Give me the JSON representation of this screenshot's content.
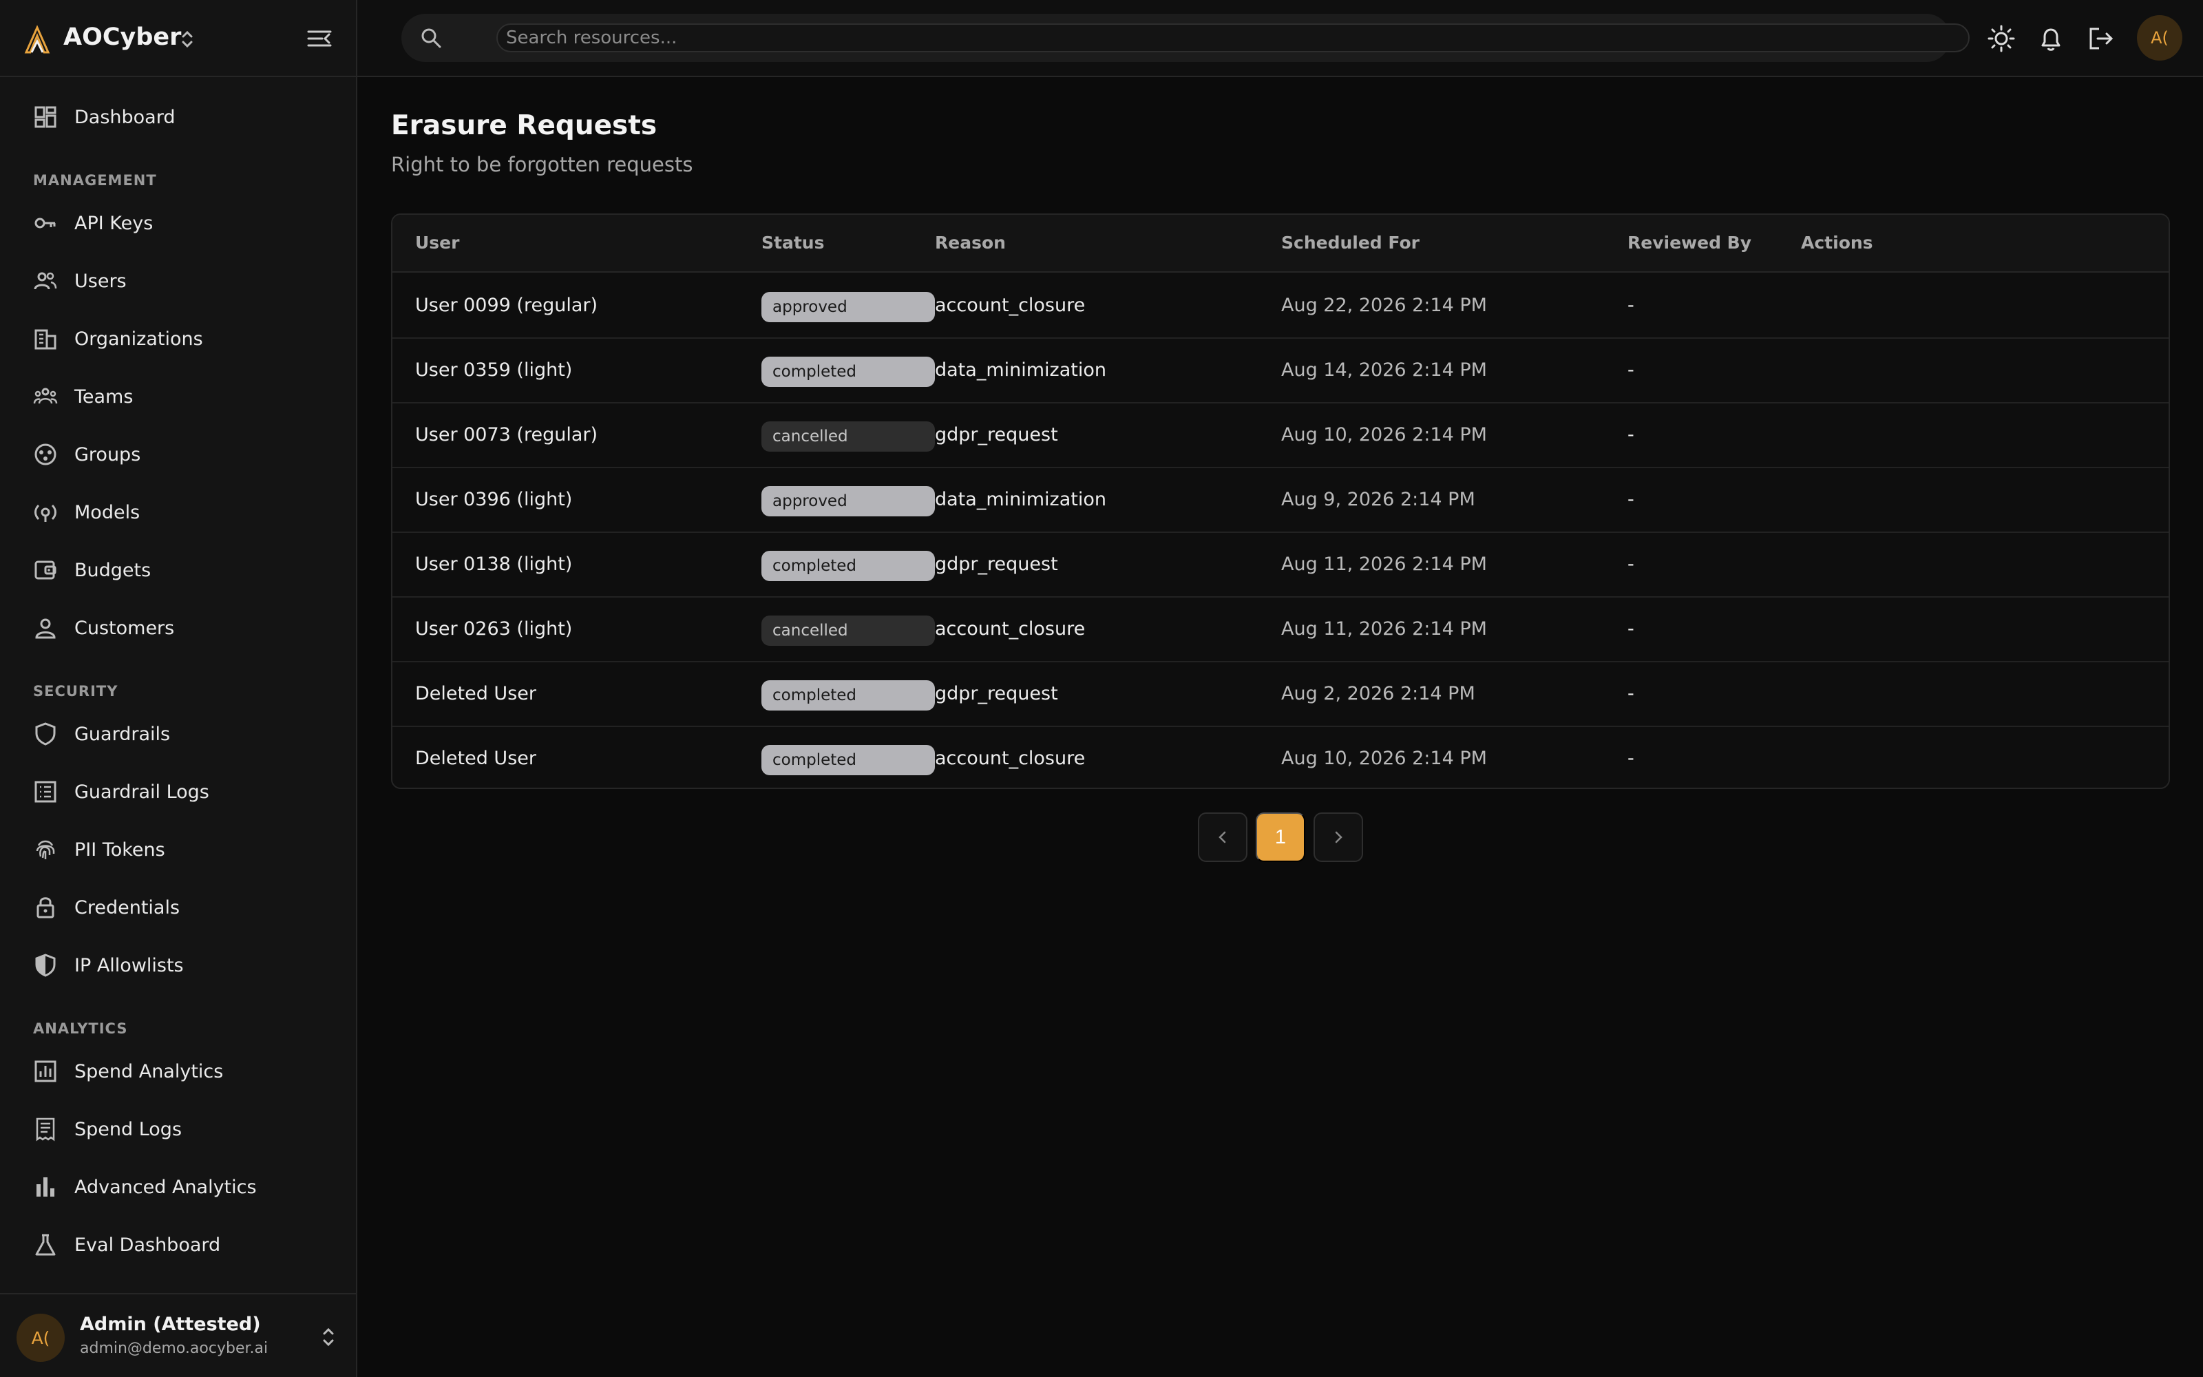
{
  "brand": {
    "name": "AOCyber"
  },
  "search": {
    "placeholder": "Search resources..."
  },
  "nav": {
    "dashboard": "Dashboard",
    "management": {
      "title": "MANAGEMENT",
      "items": [
        "API Keys",
        "Users",
        "Organizations",
        "Teams",
        "Groups",
        "Models",
        "Budgets",
        "Customers"
      ]
    },
    "security": {
      "title": "SECURITY",
      "items": [
        "Guardrails",
        "Guardrail Logs",
        "PII Tokens",
        "Credentials",
        "IP Allowlists"
      ]
    },
    "analytics": {
      "title": "ANALYTICS",
      "items": [
        "Spend Analytics",
        "Spend Logs",
        "Advanced Analytics",
        "Eval Dashboard"
      ]
    }
  },
  "user": {
    "initials": "A(",
    "name": "Admin (Attested)",
    "email": "admin@demo.aocyber.ai"
  },
  "page": {
    "title": "Erasure Requests",
    "subtitle": "Right to be forgotten requests"
  },
  "table": {
    "headers": {
      "user": "User",
      "status": "Status",
      "reason": "Reason",
      "scheduled": "Scheduled For",
      "reviewed": "Reviewed By",
      "actions": "Actions"
    },
    "rows": [
      {
        "user": "User 0099 (regular)",
        "status": "approved",
        "reason": "account_closure",
        "scheduled": "Aug 22, 2026 2:14 PM",
        "reviewed": "-"
      },
      {
        "user": "User 0359 (light)",
        "status": "completed",
        "reason": "data_minimization",
        "scheduled": "Aug 14, 2026 2:14 PM",
        "reviewed": "-"
      },
      {
        "user": "User 0073 (regular)",
        "status": "cancelled",
        "reason": "gdpr_request",
        "scheduled": "Aug 10, 2026 2:14 PM",
        "reviewed": "-"
      },
      {
        "user": "User 0396 (light)",
        "status": "approved",
        "reason": "data_minimization",
        "scheduled": "Aug 9, 2026 2:14 PM",
        "reviewed": "-"
      },
      {
        "user": "User 0138 (light)",
        "status": "completed",
        "reason": "gdpr_request",
        "scheduled": "Aug 11, 2026 2:14 PM",
        "reviewed": "-"
      },
      {
        "user": "User 0263 (light)",
        "status": "cancelled",
        "reason": "account_closure",
        "scheduled": "Aug 11, 2026 2:14 PM",
        "reviewed": "-"
      },
      {
        "user": "Deleted User",
        "status": "completed",
        "reason": "gdpr_request",
        "scheduled": "Aug 2, 2026 2:14 PM",
        "reviewed": "-"
      },
      {
        "user": "Deleted User",
        "status": "completed",
        "reason": "account_closure",
        "scheduled": "Aug 10, 2026 2:14 PM",
        "reviewed": "-"
      }
    ]
  },
  "pagination": {
    "current": "1"
  },
  "colors": {
    "accent": "#e8a33d",
    "background": "#0b0b0b",
    "sidebar": "#141414"
  }
}
